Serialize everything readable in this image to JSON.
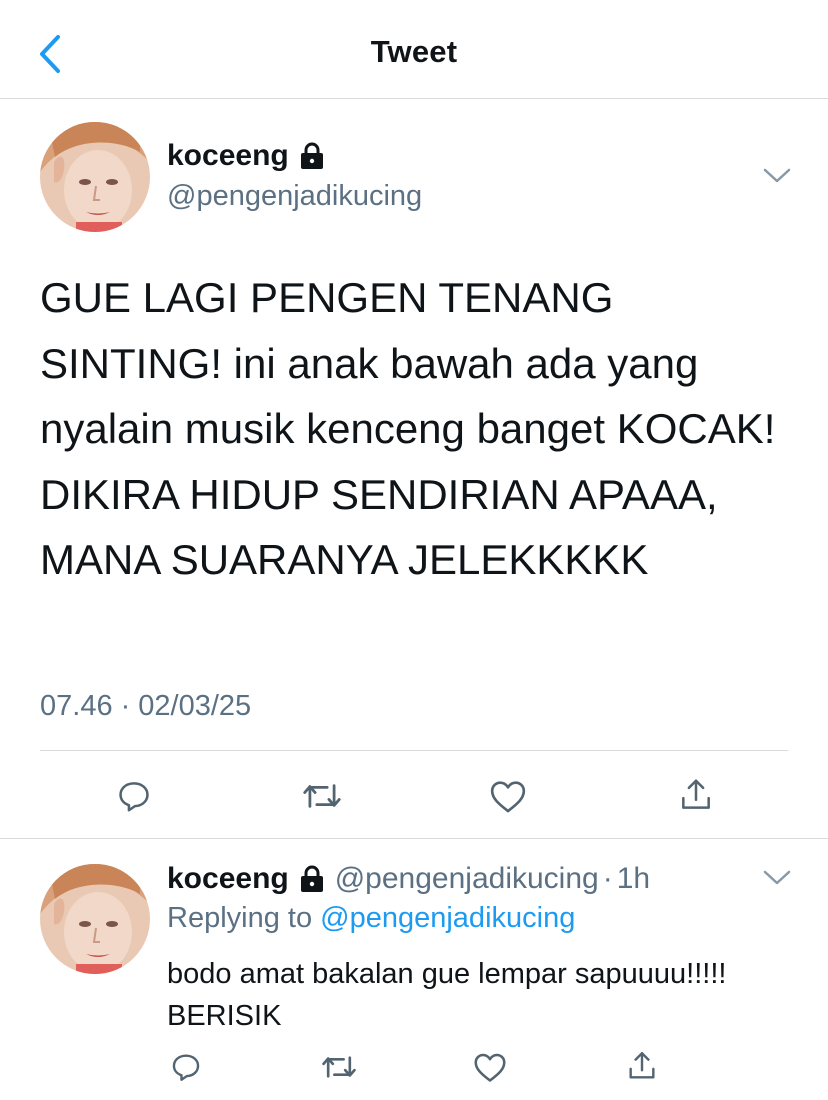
{
  "header": {
    "title": "Tweet"
  },
  "main_tweet": {
    "name": "koceeng",
    "handle": "@pengenjadikucing",
    "text": "GUE LAGI PENGEN TENANG SINTING! ini anak bawah ada yang nyalain musik kenceng banget KOCAK! DIKIRA HIDUP SENDIRIAN APAAA, MANA SUARANYA JELEKKKKK",
    "time": "07.46",
    "separator": "·",
    "date": "02/03/25"
  },
  "reply_tweet": {
    "name": "koceeng",
    "handle": "@pengenjadikucing",
    "separator": "·",
    "time": "1h",
    "replying_prefix": "Replying to",
    "replying_to": "@pengenjadikucing",
    "text": "bodo amat bakalan gue lempar sapuuuu!!!!! BERISIK"
  },
  "colors": {
    "text_primary": "#0f1419",
    "text_secondary": "#5b7083",
    "accent": "#1d9bf0",
    "divider": "#d6dadd"
  },
  "icons": {
    "back": "chevron-left-icon",
    "lock": "lock-icon",
    "more": "chevron-down-icon",
    "reply": "comment-icon",
    "retweet": "retweet-icon",
    "like": "heart-icon",
    "share": "share-icon"
  }
}
